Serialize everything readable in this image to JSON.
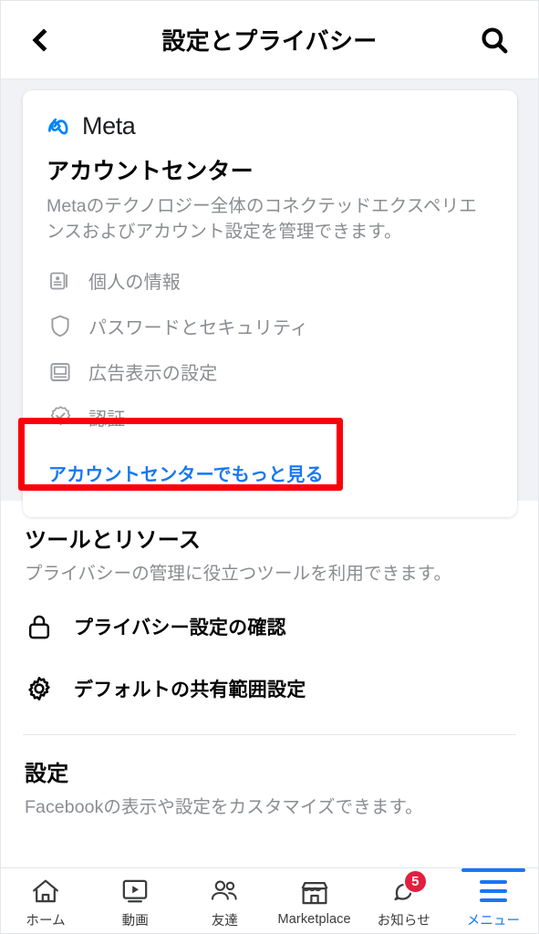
{
  "header": {
    "title": "設定とプライバシー",
    "back_icon": "chevron-left-icon",
    "search_icon": "search-icon"
  },
  "account_center_card": {
    "brand": "Meta",
    "brand_logo_icon": "meta-infinity-logo",
    "title": "アカウントセンター",
    "description": "Metaのテクノロジー全体のコネクテッドエクスペリエンスおよびアカウント設定を管理できます。",
    "items": [
      {
        "icon": "id-card-icon",
        "label": "個人の情報"
      },
      {
        "icon": "shield-icon",
        "label": "パスワードとセキュリティ"
      },
      {
        "icon": "monitor-ad-icon",
        "label": "広告表示の設定"
      },
      {
        "icon": "verified-badge-icon",
        "label": "認証"
      }
    ],
    "cta_label": "アカウントセンターでもっと見る",
    "cta_color": "#1877f2"
  },
  "annotation": {
    "type": "red-highlight-box",
    "color": "#fb0007",
    "targets": "cta_label"
  },
  "tools_section": {
    "title": "ツールとリソース",
    "subtitle": "プライバシーの管理に役立つツールを利用できます。",
    "items": [
      {
        "icon": "lock-icon",
        "label": "プライバシー設定の確認"
      },
      {
        "icon": "gear-icon",
        "label": "デフォルトの共有範囲設定"
      }
    ]
  },
  "settings_section": {
    "title": "設定",
    "subtitle": "Facebookの表示や設定をカスタマイズできます。"
  },
  "bottom_nav": {
    "active_color": "#1877f2",
    "badge_color": "#e41e3f",
    "items": [
      {
        "icon": "home-icon",
        "label": "ホーム",
        "active": false,
        "badge": ""
      },
      {
        "icon": "video-icon",
        "label": "動画",
        "active": false,
        "badge": ""
      },
      {
        "icon": "friends-icon",
        "label": "友達",
        "active": false,
        "badge": ""
      },
      {
        "icon": "marketplace-icon",
        "label": "Marketplace",
        "active": false,
        "badge": ""
      },
      {
        "icon": "bell-icon",
        "label": "お知らせ",
        "active": false,
        "badge": "5"
      },
      {
        "icon": "hamburger-menu-icon",
        "label": "メニュー",
        "active": true,
        "badge": ""
      }
    ]
  }
}
